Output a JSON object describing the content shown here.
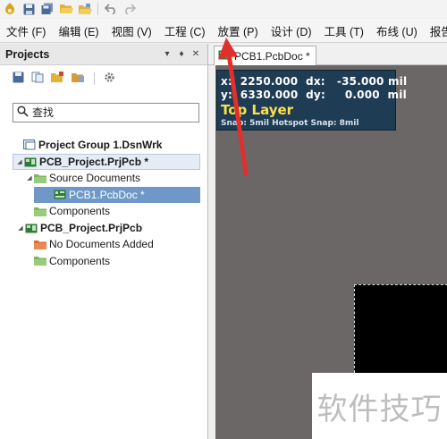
{
  "toolbar": {
    "icons": [
      "app-logo-icon",
      "save-icon",
      "save-all-icon",
      "open-folder-icon",
      "open-project-icon",
      "undo-icon",
      "redo-icon"
    ]
  },
  "menubar": {
    "items": [
      {
        "label": "文件 (F)"
      },
      {
        "label": "编辑 (E)"
      },
      {
        "label": "视图 (V)"
      },
      {
        "label": "工程 (C)"
      },
      {
        "label": "放置 (P)"
      },
      {
        "label": "设计 (D)"
      },
      {
        "label": "工具 (T)"
      },
      {
        "label": "布线 (U)"
      },
      {
        "label": "报告 (R)"
      }
    ]
  },
  "projects_panel": {
    "title": "Projects",
    "controls": [
      "▾",
      "♦",
      "✕"
    ],
    "search": {
      "placeholder": "查找",
      "value": ""
    },
    "tree": [
      {
        "label": "Project Group 1.DsnWrk",
        "bold": true,
        "icon": "project-group-icon",
        "level": 0,
        "expander": ""
      },
      {
        "label": "PCB_Project.PrjPcb *",
        "bold": true,
        "icon": "pcb-project-icon",
        "level": 1,
        "expander": "◢",
        "selected": "light"
      },
      {
        "label": "Source Documents",
        "icon": "folder-icon",
        "level": 2,
        "expander": "◢"
      },
      {
        "label": "PCB1.PcbDoc *",
        "icon": "pcb-doc-icon",
        "level": 3,
        "expander": "",
        "selected": "dark"
      },
      {
        "label": "Components",
        "icon": "folder-icon",
        "level": 2,
        "expander": ""
      },
      {
        "label": "PCB_Project.PrjPcb",
        "bold": true,
        "icon": "pcb-project-icon",
        "level": 1,
        "expander": "◢"
      },
      {
        "label": "No Documents Added",
        "icon": "folder-empty-icon",
        "level": 2,
        "expander": ""
      },
      {
        "label": "Components",
        "icon": "folder-icon",
        "level": 2,
        "expander": ""
      }
    ]
  },
  "document": {
    "tab_label": "PCB1.PcbDoc *",
    "hud": {
      "line1": "x:  2250.000  dx:   -35.000 mil",
      "line2": "y:  6330.000  dy:     0.000  mil",
      "layer": "Top Layer",
      "snap": "Snap: 5mil Hotspot Snap: 8mil"
    }
  },
  "watermark": {
    "text": "软件技巧"
  },
  "colors": {
    "canvas": "#6b6766",
    "hud_bg": "#1f3c55",
    "layer_text": "#ffe04a",
    "selection": "#6f98c9",
    "annotation_arrow": "#e0302c"
  }
}
